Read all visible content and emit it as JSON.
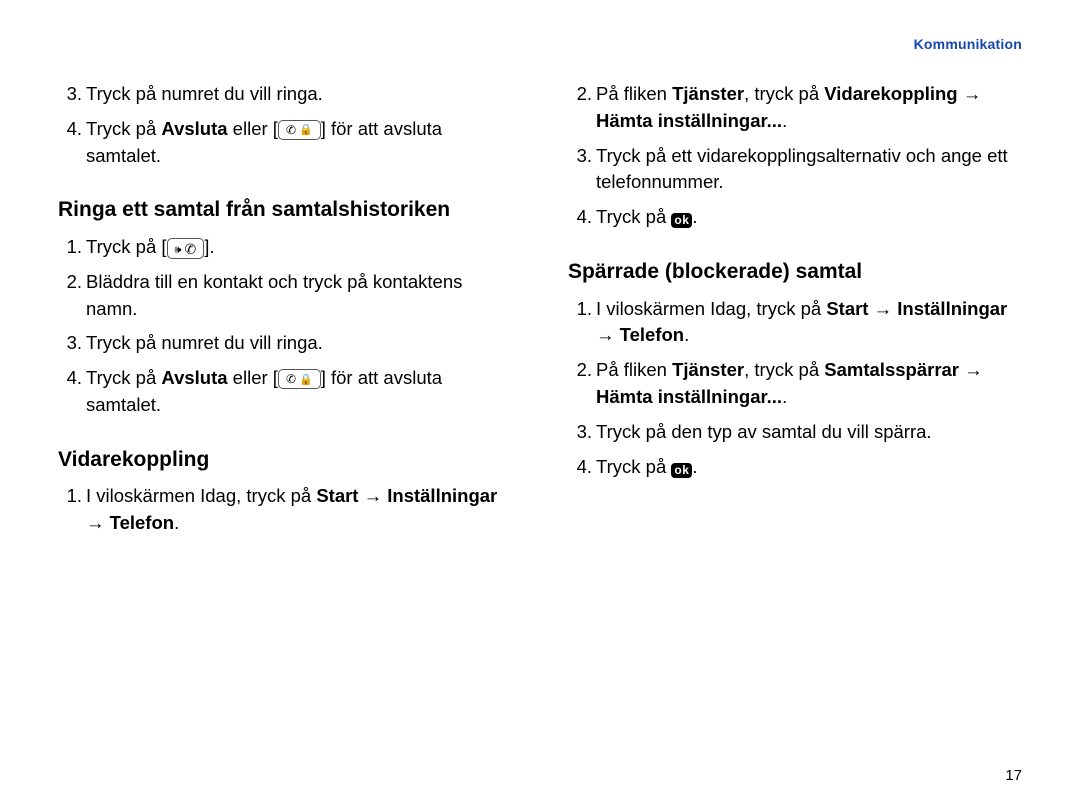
{
  "header": {
    "section": "Kommunikation"
  },
  "page_number": "17",
  "left": {
    "intro_steps": [
      {
        "n": "3.",
        "text": "Tryck på numret du vill ringa."
      },
      {
        "n": "4.",
        "pre": "Tryck på ",
        "bold": "Avsluta",
        "post1": " eller [",
        "post2": "] för att avsluta samtalet.",
        "endcall_icon": true
      }
    ],
    "h_history": "Ringa ett samtal från samtalshistoriken",
    "history_steps": [
      {
        "n": "1.",
        "text_pre": "Tryck på [",
        "text_post": "].",
        "call_icon": true
      },
      {
        "n": "2.",
        "text": "Bläddra till en kontakt och tryck på kontaktens namn."
      },
      {
        "n": "3.",
        "text": "Tryck på numret du vill ringa."
      },
      {
        "n": "4.",
        "pre": "Tryck på ",
        "bold": "Avsluta",
        "post1": " eller [",
        "post2": "] för att avsluta samtalet.",
        "endcall_icon": true
      }
    ],
    "h_forward": "Vidarekoppling",
    "forward_steps": [
      {
        "n": "1.",
        "pre": "I viloskärmen Idag, tryck på ",
        "b1": "Start",
        "arrow1": " → ",
        "b2": "Inställningar",
        "arrow2": " → ",
        "b3": "Telefon",
        "tail": "."
      }
    ]
  },
  "right": {
    "forward_cont": [
      {
        "n": "2.",
        "pre": "På fliken ",
        "b1": "Tjänster",
        "mid": ", tryck på ",
        "b2": "Vidarekoppling",
        "arrow": " → ",
        "b3": "Hämta inställningar...",
        "tail": "."
      },
      {
        "n": "3.",
        "text": "Tryck på ett vidarekopplingsalternativ och ange ett telefonnummer."
      },
      {
        "n": "4.",
        "pre": "Tryck på ",
        "ok": true,
        "tail": "."
      }
    ],
    "h_block": "Spärrade (blockerade) samtal",
    "block_steps": [
      {
        "n": "1.",
        "pre": "I viloskärmen Idag, tryck på ",
        "b1": "Start",
        "arrow1": " → ",
        "b2": "Inställningar",
        "arrow2": " → ",
        "b3": "Telefon",
        "tail": "."
      },
      {
        "n": "2.",
        "pre": "På fliken ",
        "b1": "Tjänster",
        "mid": ", tryck på ",
        "b2": "Samtalsspärrar",
        "arrow": " → ",
        "b3": "Hämta inställningar...",
        "tail": "."
      },
      {
        "n": "3.",
        "text": "Tryck på den typ av samtal du vill spärra."
      },
      {
        "n": "4.",
        "pre": "Tryck på ",
        "ok": true,
        "tail": "."
      }
    ]
  },
  "icons": {
    "call": "✆",
    "end": "✆",
    "lock": "🔒",
    "sound": "🕪",
    "ok": "ok"
  }
}
